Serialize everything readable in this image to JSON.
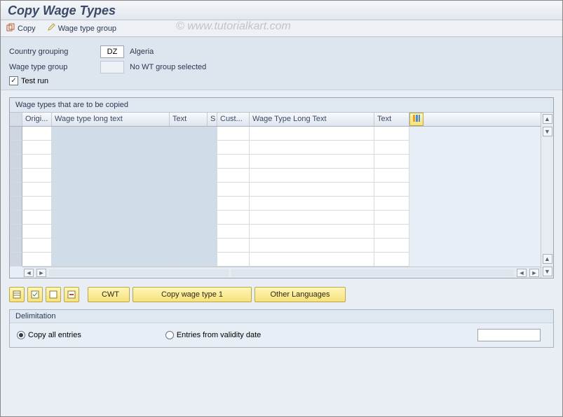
{
  "title": "Copy Wage Types",
  "toolbar": {
    "copy_label": "Copy",
    "wt_group_label": "Wage type group"
  },
  "watermark": "© www.tutorialkart.com",
  "form": {
    "country_label": "Country grouping",
    "country_value": "DZ",
    "country_text": "Algeria",
    "wt_group_label": "Wage type group",
    "wt_group_value": "",
    "wt_group_text": "No WT group selected",
    "test_run_label": "Test run",
    "test_run_checked": true
  },
  "grid": {
    "title": "Wage types that are to be copied",
    "columns": {
      "origi": "Origi...",
      "wtlt": "Wage type long text",
      "text": "Text",
      "s": "S",
      "cust": "Cust...",
      "wtlt2": "Wage Type Long Text",
      "text2": "Text"
    },
    "row_count": 10
  },
  "buttons": {
    "cwt": "CWT",
    "copy1": "Copy wage type 1",
    "other_lang": "Other Languages"
  },
  "delimitation": {
    "title": "Delimitation",
    "copy_all_label": "Copy all entries",
    "from_date_label": "Entries from validity date",
    "selected": "copy_all",
    "date_value": ""
  }
}
